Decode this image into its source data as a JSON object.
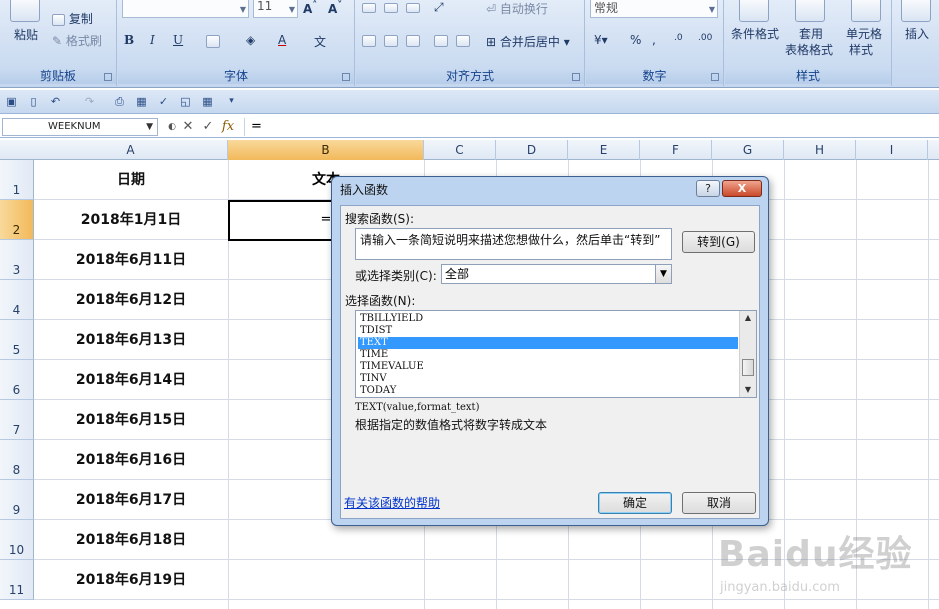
{
  "ribbon": {
    "clipboard": {
      "paste": "粘贴",
      "copy": "复制",
      "format_painter": "格式刷",
      "label": "剪贴板"
    },
    "font": {
      "size": "11",
      "label": "字体"
    },
    "alignment": {
      "wrap": "自动换行",
      "merge": "合并后居中",
      "label": "对齐方式"
    },
    "number": {
      "format": "常规",
      "label": "数字"
    },
    "styles": {
      "cond_format": "条件格式",
      "table_fmt_line1": "套用",
      "table_fmt_line2": "表格格式",
      "cell_style_line1": "单元格",
      "cell_style_line2": "样式",
      "label": "样式"
    },
    "cells": {
      "insert": "插入"
    }
  },
  "formula_bar": {
    "name_box": "WEEKNUM",
    "fx": "fx",
    "formula": "="
  },
  "columns": [
    "A",
    "B",
    "C",
    "D",
    "E",
    "F",
    "G",
    "H",
    "I"
  ],
  "rows": [
    "1",
    "2",
    "3",
    "4",
    "5",
    "6",
    "7",
    "8",
    "9",
    "10",
    "11"
  ],
  "sheet": {
    "a1": "日期",
    "b1": "文本",
    "b2": "=",
    "dates": [
      "2018年1月1日",
      "2018年6月11日",
      "2018年6月12日",
      "2018年6月13日",
      "2018年6月14日",
      "2018年6月15日",
      "2018年6月16日",
      "2018年6月17日",
      "2018年6月18日",
      "2018年6月19日"
    ]
  },
  "dialog": {
    "title": "插入函数",
    "help_btn": "?",
    "close_btn": "X",
    "search_label": "搜索函数(S):",
    "search_text": "请输入一条简短说明来描述您想做什么，然后单击“转到”",
    "go_btn": "转到(G)",
    "category_label": "或选择类别(C):",
    "category_value": "全部",
    "function_label": "选择函数(N):",
    "functions": [
      "TBILLYIELD",
      "TDIST",
      "TEXT",
      "TIME",
      "TIMEVALUE",
      "TINV",
      "TODAY"
    ],
    "selected_function": "TEXT",
    "syntax": "TEXT(value,format_text)",
    "description": "根据指定的数值格式将数字转成文本",
    "help_link": "有关该函数的帮助",
    "ok_btn": "确定",
    "cancel_btn": "取消"
  },
  "watermark": {
    "brand": "Baidu经验",
    "url": "jingyan.baidu.com"
  }
}
